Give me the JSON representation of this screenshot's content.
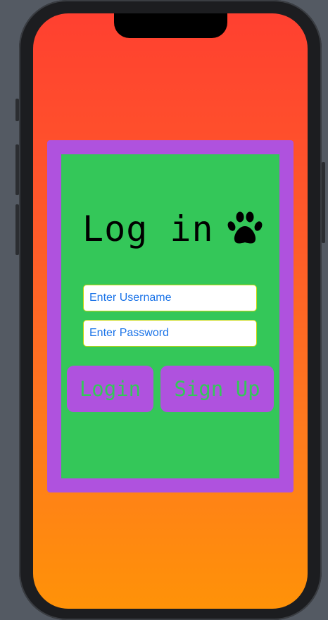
{
  "login": {
    "title": "Log in",
    "username_placeholder": "Enter Username",
    "password_placeholder": "Enter Password",
    "login_label": "Login",
    "signup_label": "Sign Up"
  },
  "icons": {
    "title_icon": "paw-icon"
  },
  "colors": {
    "background_gradient_top": "#ff4030",
    "background_gradient_bottom": "#ff9208",
    "card_border": "#af52de",
    "card_fill": "#34c759",
    "button_fill": "#af52de",
    "button_text": "#34c759",
    "field_text": "#1a73e8"
  }
}
